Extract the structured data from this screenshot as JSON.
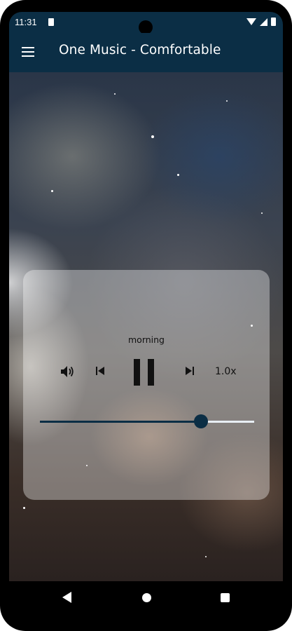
{
  "status": {
    "time": "11:31"
  },
  "appbar": {
    "title": "One Music - Comfortable",
    "menu_icon": "hamburger-menu-icon"
  },
  "player": {
    "track_title": "morning",
    "speed": "1.0x",
    "progress": 0.75,
    "icons": [
      "volume-icon",
      "skip-previous-icon",
      "pause-icon",
      "skip-next-icon"
    ]
  },
  "colors": {
    "primary": "#0b2e45",
    "card": "rgba(255,255,255,0.36)"
  },
  "navbar": {
    "icons": [
      "back-icon",
      "home-icon",
      "recents-icon"
    ]
  }
}
